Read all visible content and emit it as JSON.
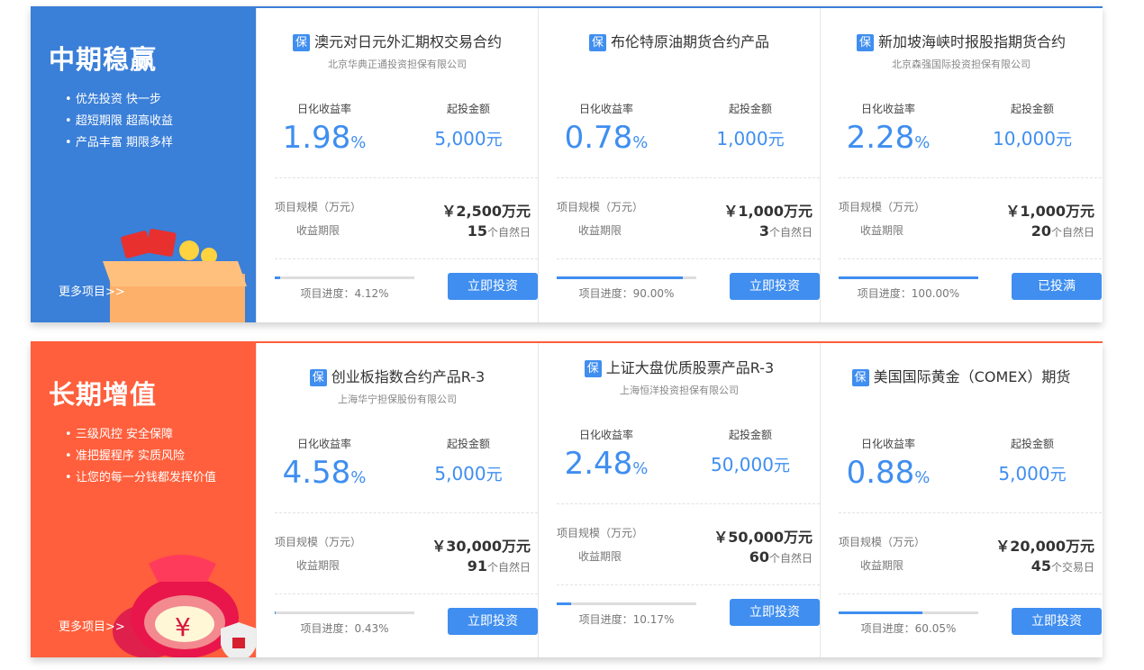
{
  "panels": [
    {
      "title": "中期稳赢",
      "bullets": [
        "优先投资  快一步",
        "超短期限  超高收益",
        "产品丰富  期限多样"
      ],
      "more": "更多项目>>",
      "cards": [
        {
          "badge": "保",
          "name": "澳元对日元外汇期权交易合约",
          "company": "北京华典正通投资担保有限公司",
          "rate_label": "日化收益率",
          "rate": "1.98",
          "rate_unit": "%",
          "min_label": "起投金额",
          "min": "5,000",
          "min_unit": "元",
          "scale_label": "项目规模（万元）",
          "scale": "￥2,500万元",
          "term_label": "收益期限",
          "term": "15",
          "term_unit": "个自然日",
          "progress": 4.12,
          "progress_text": "项目进度：4.12%",
          "button": "立即投资"
        },
        {
          "badge": "保",
          "name": "布伦特原油期货合约产品",
          "company": "",
          "rate_label": "日化收益率",
          "rate": "0.78",
          "rate_unit": "%",
          "min_label": "起投金额",
          "min": "1,000",
          "min_unit": "元",
          "scale_label": "项目规模（万元）",
          "scale": "￥1,000万元",
          "term_label": "收益期限",
          "term": "3",
          "term_unit": "个自然日",
          "progress": 90,
          "progress_text": "项目进度：90.00%",
          "button": "立即投资"
        },
        {
          "badge": "保",
          "name": "新加坡海峡时报股指期货合约",
          "company": "北京森强国际投资担保有限公司",
          "rate_label": "日化收益率",
          "rate": "2.28",
          "rate_unit": "%",
          "min_label": "起投金额",
          "min": "10,000",
          "min_unit": "元",
          "scale_label": "项目规模（万元）",
          "scale": "￥1,000万元",
          "term_label": "收益期限",
          "term": "20",
          "term_unit": "个自然日",
          "progress": 100,
          "progress_text": "项目进度：100.00%",
          "button": "已投满"
        }
      ]
    },
    {
      "title": "长期增值",
      "bullets": [
        "三级风控  安全保障",
        "准把握程序  实质风险",
        "让您的每一分钱都发挥价值"
      ],
      "more": "更多项目>>",
      "cards": [
        {
          "badge": "保",
          "name": "创业板指数合约产品R-3",
          "company": "上海华宁担保股份有限公司",
          "rate_label": "日化收益率",
          "rate": "4.58",
          "rate_unit": "%",
          "min_label": "起投金额",
          "min": "5,000",
          "min_unit": "元",
          "scale_label": "项目规模（万元）",
          "scale": "￥30,000万元",
          "term_label": "收益期限",
          "term": "91",
          "term_unit": "个自然日",
          "progress": 0.43,
          "progress_text": "项目进度：0.43%",
          "button": "立即投资"
        },
        {
          "badge": "保",
          "name": "上证大盘优质股票产品R-3",
          "company": "上海恒洋投资担保有限公司",
          "rate_label": "日化收益率",
          "rate": "2.48",
          "rate_unit": "%",
          "min_label": "起投金额",
          "min": "50,000",
          "min_unit": "元",
          "scale_label": "项目规模（万元）",
          "scale": "￥50,000万元",
          "term_label": "收益期限",
          "term": "60",
          "term_unit": "个自然日",
          "progress": 10.17,
          "progress_text": "项目进度：10.17%",
          "button": "立即投资"
        },
        {
          "badge": "保",
          "name": "美国国际黄金（COMEX）期货",
          "company": "",
          "rate_label": "日化收益率",
          "rate": "0.88",
          "rate_unit": "%",
          "min_label": "起投金额",
          "min": "5,000",
          "min_unit": "元",
          "scale_label": "项目规模（万元）",
          "scale": "￥20,000万元",
          "term_label": "收益期限",
          "term": "45",
          "term_unit": "个交易日",
          "progress": 60.05,
          "progress_text": "项目进度：60.05%",
          "button": "立即投资"
        }
      ]
    }
  ]
}
